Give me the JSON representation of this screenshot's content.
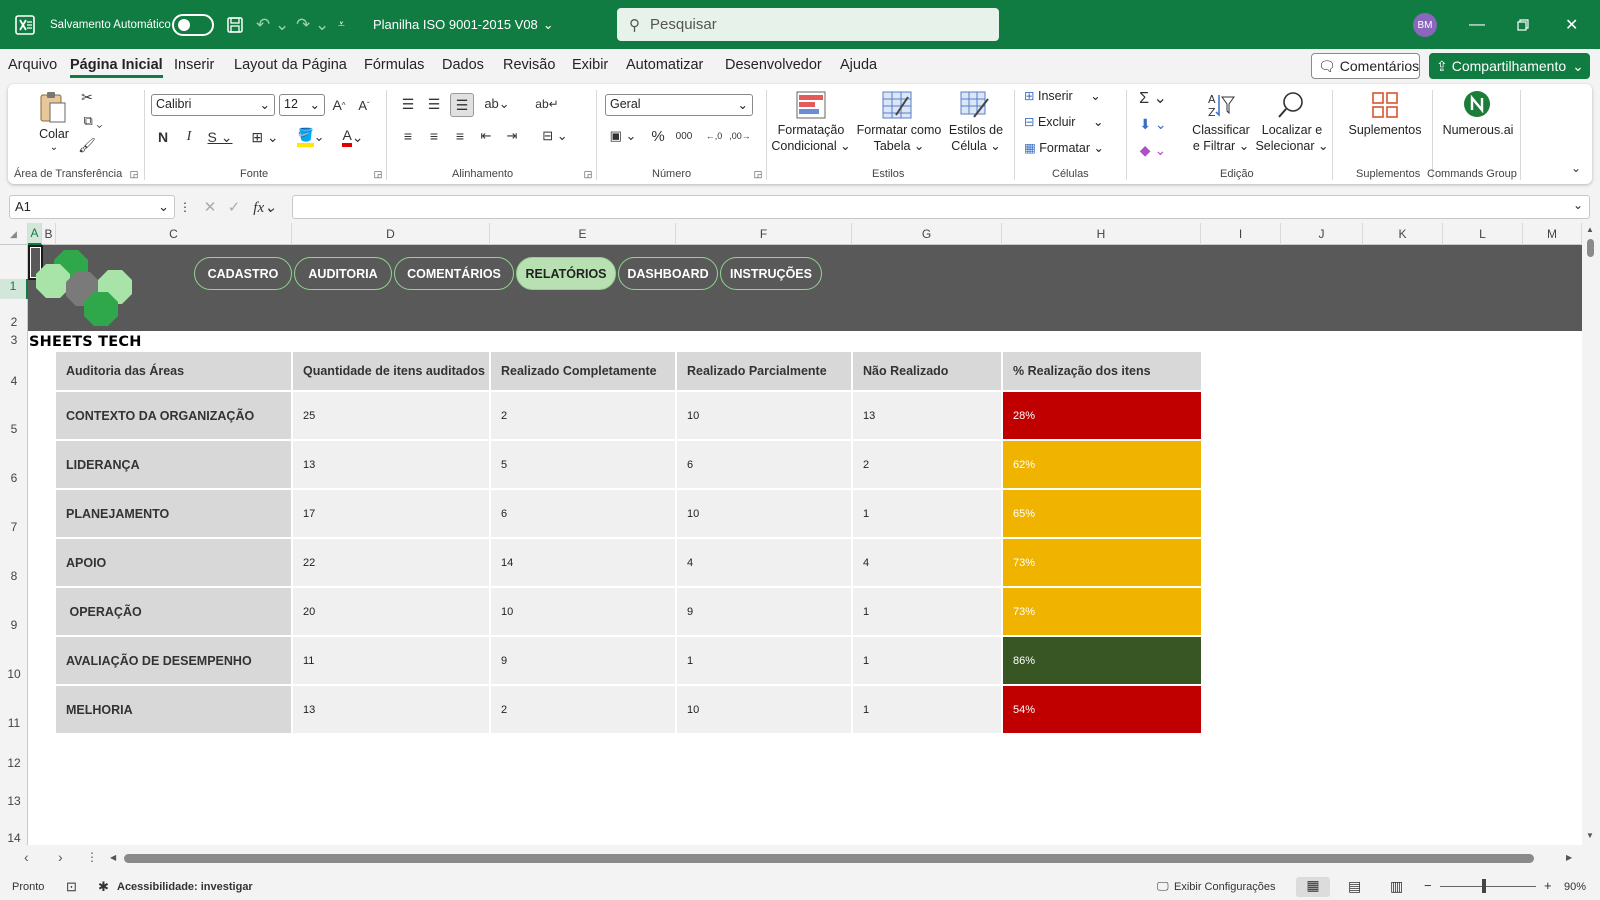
{
  "titlebar": {
    "autosave_label": "Salvamento Automático",
    "file_name": "Planilha ISO 9001-2015 V08",
    "search_placeholder": "Pesquisar",
    "user_initials": "BM"
  },
  "menu": {
    "items": [
      "Arquivo",
      "Página Inicial",
      "Inserir",
      "Layout da Página",
      "Fórmulas",
      "Dados",
      "Revisão",
      "Exibir",
      "Automatizar",
      "Desenvolvedor",
      "Ajuda"
    ],
    "active": "Página Inicial",
    "comments_label": "Comentários",
    "share_label": "Compartilhamento"
  },
  "ribbon": {
    "clipboard": {
      "paste_label": "Colar",
      "group_label": "Área de Transferência"
    },
    "font": {
      "font_name": "Calibri",
      "font_size": "12",
      "group_label": "Fonte"
    },
    "alignment": {
      "group_label": "Alinhamento"
    },
    "number": {
      "format": "Geral",
      "group_label": "Número"
    },
    "styles": {
      "conditional_label1": "Formatação",
      "conditional_label2": "Condicional",
      "table_label1": "Formatar como",
      "table_label2": "Tabela",
      "cell_styles_label1": "Estilos de",
      "cell_styles_label2": "Célula",
      "group_label": "Estilos"
    },
    "cells": {
      "insert_label": "Inserir",
      "delete_label": "Excluir",
      "format_label": "Formatar",
      "group_label": "Células"
    },
    "editing": {
      "sort_label1": "Classificar",
      "sort_label2": "e Filtrar",
      "find_label1": "Localizar e",
      "find_label2": "Selecionar",
      "group_label": "Edição"
    },
    "addins": {
      "label": "Suplementos",
      "group_label": "Suplementos"
    },
    "commands": {
      "label": "Numerous.ai",
      "group_label": "Commands Group"
    }
  },
  "formula_bar": {
    "name_box": "A1",
    "formula": ""
  },
  "columns": [
    "A",
    "B",
    "C",
    "D",
    "E",
    "F",
    "G",
    "H",
    "I",
    "J",
    "K",
    "L",
    "M"
  ],
  "rows": [
    "1",
    "2",
    "3",
    "4",
    "5",
    "6",
    "7",
    "8",
    "9",
    "10",
    "11",
    "12",
    "13",
    "14"
  ],
  "sheet": {
    "brand": "SHEETS TECH",
    "nav_buttons": [
      "CADASTRO",
      "AUDITORIA",
      "COMENTÁRIOS",
      "RELATÓRIOS",
      "DASHBOARD",
      "INSTRUÇÕES"
    ],
    "active_nav": "RELATÓRIOS",
    "table": {
      "headers": [
        "Auditoria das Áreas",
        "Quantidade de itens auditados",
        "Realizado Completamente",
        "Realizado Parcialmente",
        "Não Realizado",
        "% Realização dos itens"
      ],
      "rows": [
        {
          "area": "CONTEXTO DA ORGANIZAÇÃO",
          "qty": "25",
          "full": "2",
          "partial": "10",
          "none": "13",
          "pct": "28%",
          "color": "#c00000"
        },
        {
          "area": "LIDERANÇA",
          "qty": "13",
          "full": "5",
          "partial": "6",
          "none": "2",
          "pct": "62%",
          "color": "#f0b400"
        },
        {
          "area": "PLANEJAMENTO",
          "qty": "17",
          "full": "6",
          "partial": "10",
          "none": "1",
          "pct": "65%",
          "color": "#f0b400"
        },
        {
          "area": "APOIO",
          "qty": "22",
          "full": "14",
          "partial": "4",
          "none": "4",
          "pct": "73%",
          "color": "#f0b400"
        },
        {
          "area": " OPERAÇÃO",
          "qty": "20",
          "full": "10",
          "partial": "9",
          "none": "1",
          "pct": "73%",
          "color": "#f0b400"
        },
        {
          "area": "AVALIAÇÃO DE DESEMPENHO",
          "qty": "11",
          "full": "9",
          "partial": "1",
          "none": "1",
          "pct": "86%",
          "color": "#375623"
        },
        {
          "area": "MELHORIA",
          "qty": "13",
          "full": "2",
          "partial": "10",
          "none": "1",
          "pct": "54%",
          "color": "#c00000"
        }
      ]
    }
  },
  "status": {
    "ready": "Pronto",
    "accessibility": "Acessibilidade: investigar",
    "display_settings": "Exibir Configurações",
    "zoom": "90%"
  },
  "colors": {
    "accent": "#107c41",
    "banner": "#595959",
    "nav_active": "#b9e0b2"
  }
}
